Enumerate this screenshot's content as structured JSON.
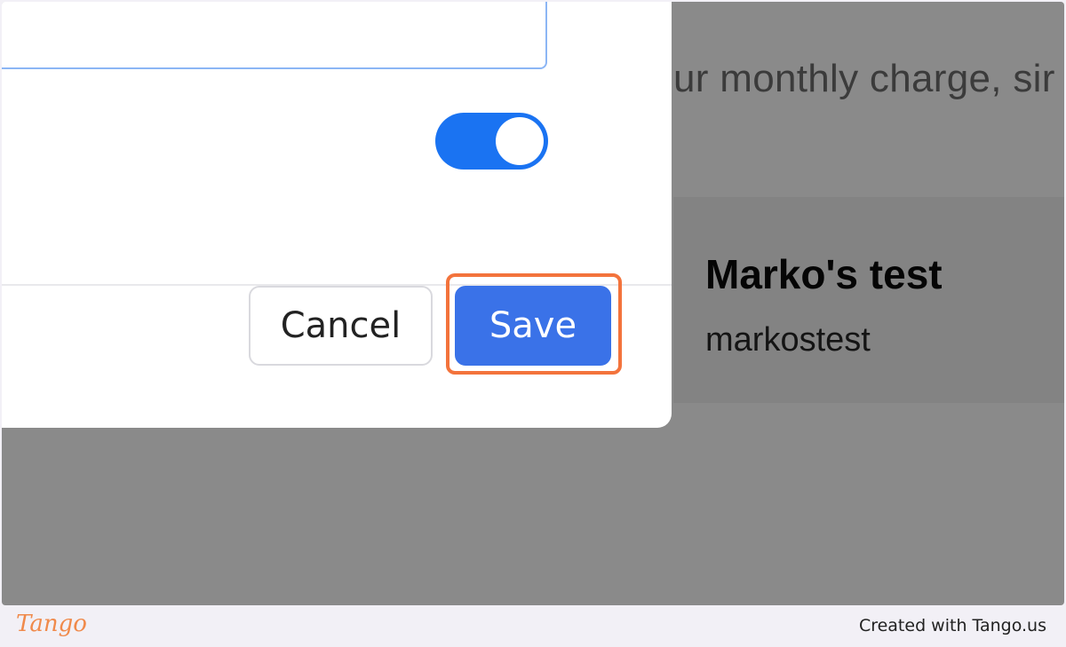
{
  "background": {
    "description_text": "ur monthly charge, sir",
    "card": {
      "title": "Marko's test",
      "subtitle": "markostest"
    }
  },
  "dialog": {
    "text_field": {
      "value": ""
    },
    "toggle": {
      "state": "on",
      "color": "#1a73f2"
    },
    "buttons": {
      "cancel_label": "Cancel",
      "save_label": "Save"
    }
  },
  "annotation": {
    "highlight_target": "save-button",
    "highlight_color": "#f3733c"
  },
  "footer": {
    "logo_text": "Tango",
    "credit": "Created with Tango.us"
  }
}
